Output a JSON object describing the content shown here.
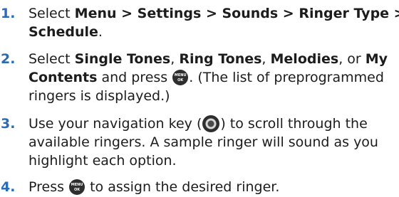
{
  "steps": [
    {
      "num": "1.",
      "lines": [
        [
          "Select ",
          {
            "b": "Menu > Settings > Sounds > Ringer Type >"
          }
        ],
        [
          {
            "b": "Schedule"
          },
          "."
        ]
      ]
    },
    {
      "num": "2.",
      "lines": [
        [
          "Select ",
          {
            "b": "Single Tones"
          },
          ", ",
          {
            "b": "Ring Tones"
          },
          ", ",
          {
            "b": "Melodies"
          },
          ", or ",
          {
            "b": "My"
          }
        ],
        [
          {
            "b": "Contents"
          },
          " and press ",
          {
            "icon": "menu-ok"
          },
          ". (The list of preprogrammed"
        ],
        [
          "ringers is displayed.)"
        ]
      ]
    },
    {
      "num": "3.",
      "lines": [
        [
          "Use your navigation key (",
          {
            "icon": "nav-key"
          },
          ") to scroll through the"
        ],
        [
          "available ringers. A sample ringer will sound as you"
        ],
        [
          "highlight each option."
        ]
      ]
    },
    {
      "num": "4.",
      "lines": [
        [
          "Press ",
          {
            "icon": "menu-ok"
          },
          " to assign the desired ringer."
        ]
      ]
    }
  ],
  "icons": {
    "menu-ok": {
      "name": "menu-ok-icon",
      "top_label": "MENU",
      "bottom_label": "OK"
    },
    "nav-key": {
      "name": "navigation-key-icon"
    }
  },
  "colors": {
    "step_number": "#2a6bb8",
    "text": "#1c1c1c",
    "icon": "#2e2e2e"
  }
}
